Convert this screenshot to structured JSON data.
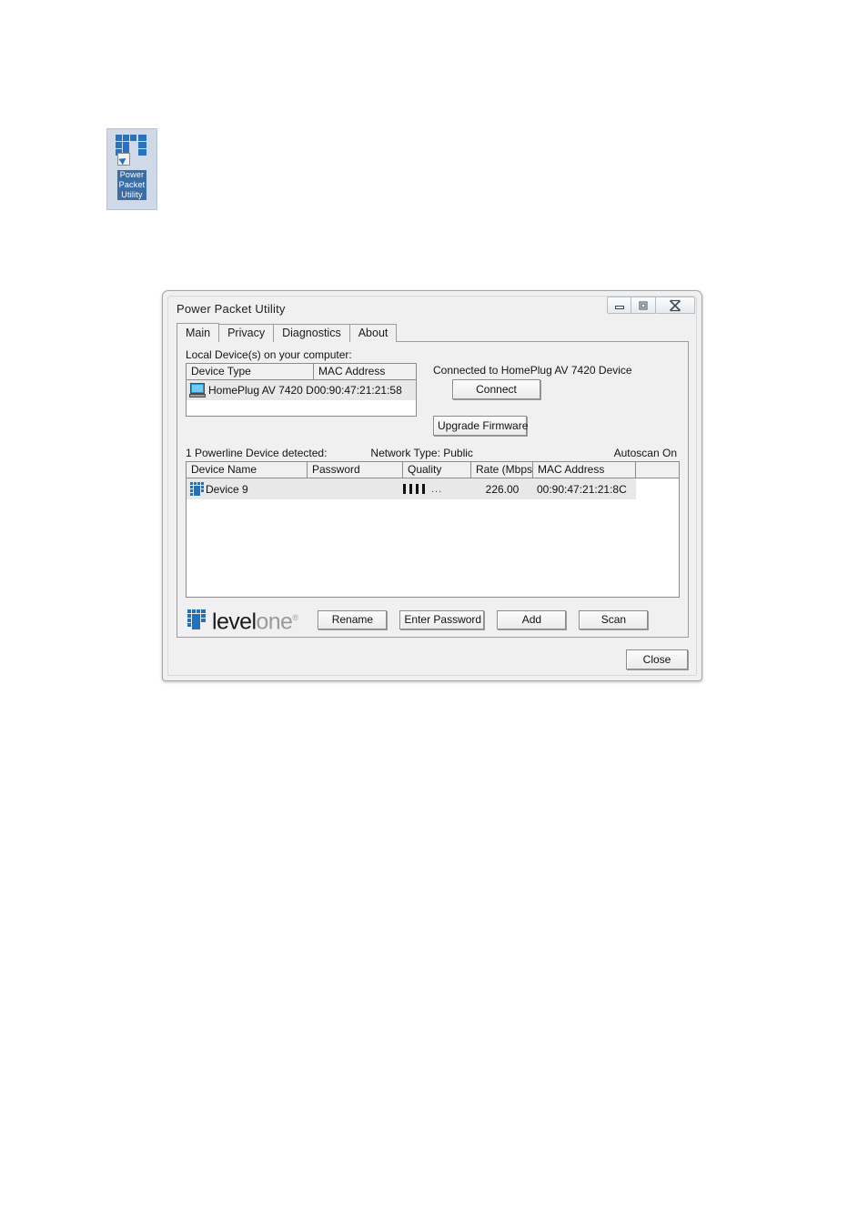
{
  "desktop": {
    "icon": {
      "name": "power-packet-utility-shortcut",
      "label_lines": [
        "Power",
        "Packet",
        "Utility"
      ],
      "selected": true,
      "brand_color": "#2b72bd"
    }
  },
  "window": {
    "title": "Power Packet Utility",
    "controls": {
      "minimize": "minimize-icon",
      "maximize": "maximize-icon",
      "close": "close-icon"
    }
  },
  "tabs": [
    {
      "label": "Main",
      "active": true
    },
    {
      "label": "Privacy",
      "active": false
    },
    {
      "label": "Diagnostics",
      "active": false
    },
    {
      "label": "About",
      "active": false
    }
  ],
  "main_tab": {
    "local_devices": {
      "section_label": "Local Device(s) on your computer:",
      "columns": [
        "Device Type",
        "MAC Address"
      ],
      "rows": [
        {
          "icon": "computer-icon",
          "device_type": "HomePlug AV 7420 D...",
          "mac_address": "00:90:47:21:21:58",
          "selected": true
        }
      ]
    },
    "connection": {
      "status_text": "Connected to HomePlug AV 7420 Device",
      "connect_label": "Connect",
      "upgrade_firmware_label": "Upgrade Firmware"
    },
    "powerline": {
      "detected_text": "1 Powerline Device detected:",
      "network_type_text": "Network Type: Public",
      "autoscan_text": "Autoscan On",
      "columns": [
        "Device Name",
        "Password",
        "Quality",
        "Rate (Mbps)",
        "MAC Address",
        ""
      ],
      "rows": [
        {
          "icon": "powerline-device-icon",
          "device_name": "Device 9",
          "password": "",
          "quality_bars": 4,
          "quality_overflow": "...",
          "rate_mbps": "226.00",
          "mac_address": "00:90:47:21:21:8C",
          "selected": true
        }
      ]
    },
    "actions": {
      "rename_label": "Rename",
      "enter_password_label": "Enter Password",
      "add_label": "Add",
      "scan_label": "Scan"
    },
    "branding": {
      "logo_primary": "level",
      "logo_secondary": "one",
      "logo_registered": "®",
      "logo_color": "#1f72bd"
    }
  },
  "footer": {
    "close_label": "Close"
  }
}
